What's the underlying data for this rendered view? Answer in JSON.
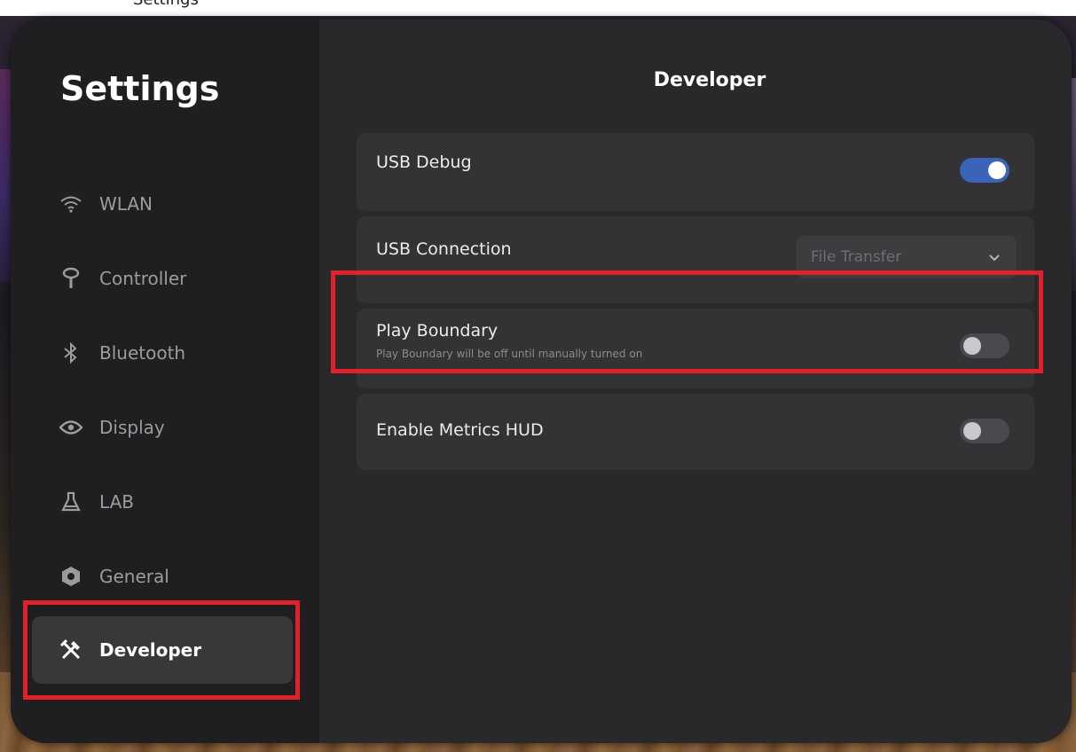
{
  "caption": "Settings",
  "sidebar": {
    "title": "Settings",
    "items": [
      {
        "label": "WLAN",
        "icon": "wifi-icon"
      },
      {
        "label": "Controller",
        "icon": "controller-icon"
      },
      {
        "label": "Bluetooth",
        "icon": "bluetooth-icon"
      },
      {
        "label": "Display",
        "icon": "eye-icon"
      },
      {
        "label": "LAB",
        "icon": "flask-icon"
      },
      {
        "label": "General",
        "icon": "hexagon-gear-icon"
      },
      {
        "label": "Developer",
        "icon": "tools-icon",
        "active": true
      }
    ]
  },
  "content": {
    "title": "Developer",
    "settings": [
      {
        "label": "USB Debug",
        "control": "toggle",
        "enabled": true
      },
      {
        "label": "USB Connection",
        "control": "dropdown",
        "value": "File Transfer"
      },
      {
        "label": "Play Boundary",
        "description": "Play Boundary will be off until manually turned on",
        "control": "toggle",
        "enabled": false
      },
      {
        "label": "Enable Metrics HUD",
        "control": "toggle",
        "enabled": false
      }
    ]
  },
  "colors": {
    "accent": "#3a64b8",
    "highlight": "#e0202b",
    "panel": "#29292b",
    "sidebar": "#1f1f21"
  }
}
